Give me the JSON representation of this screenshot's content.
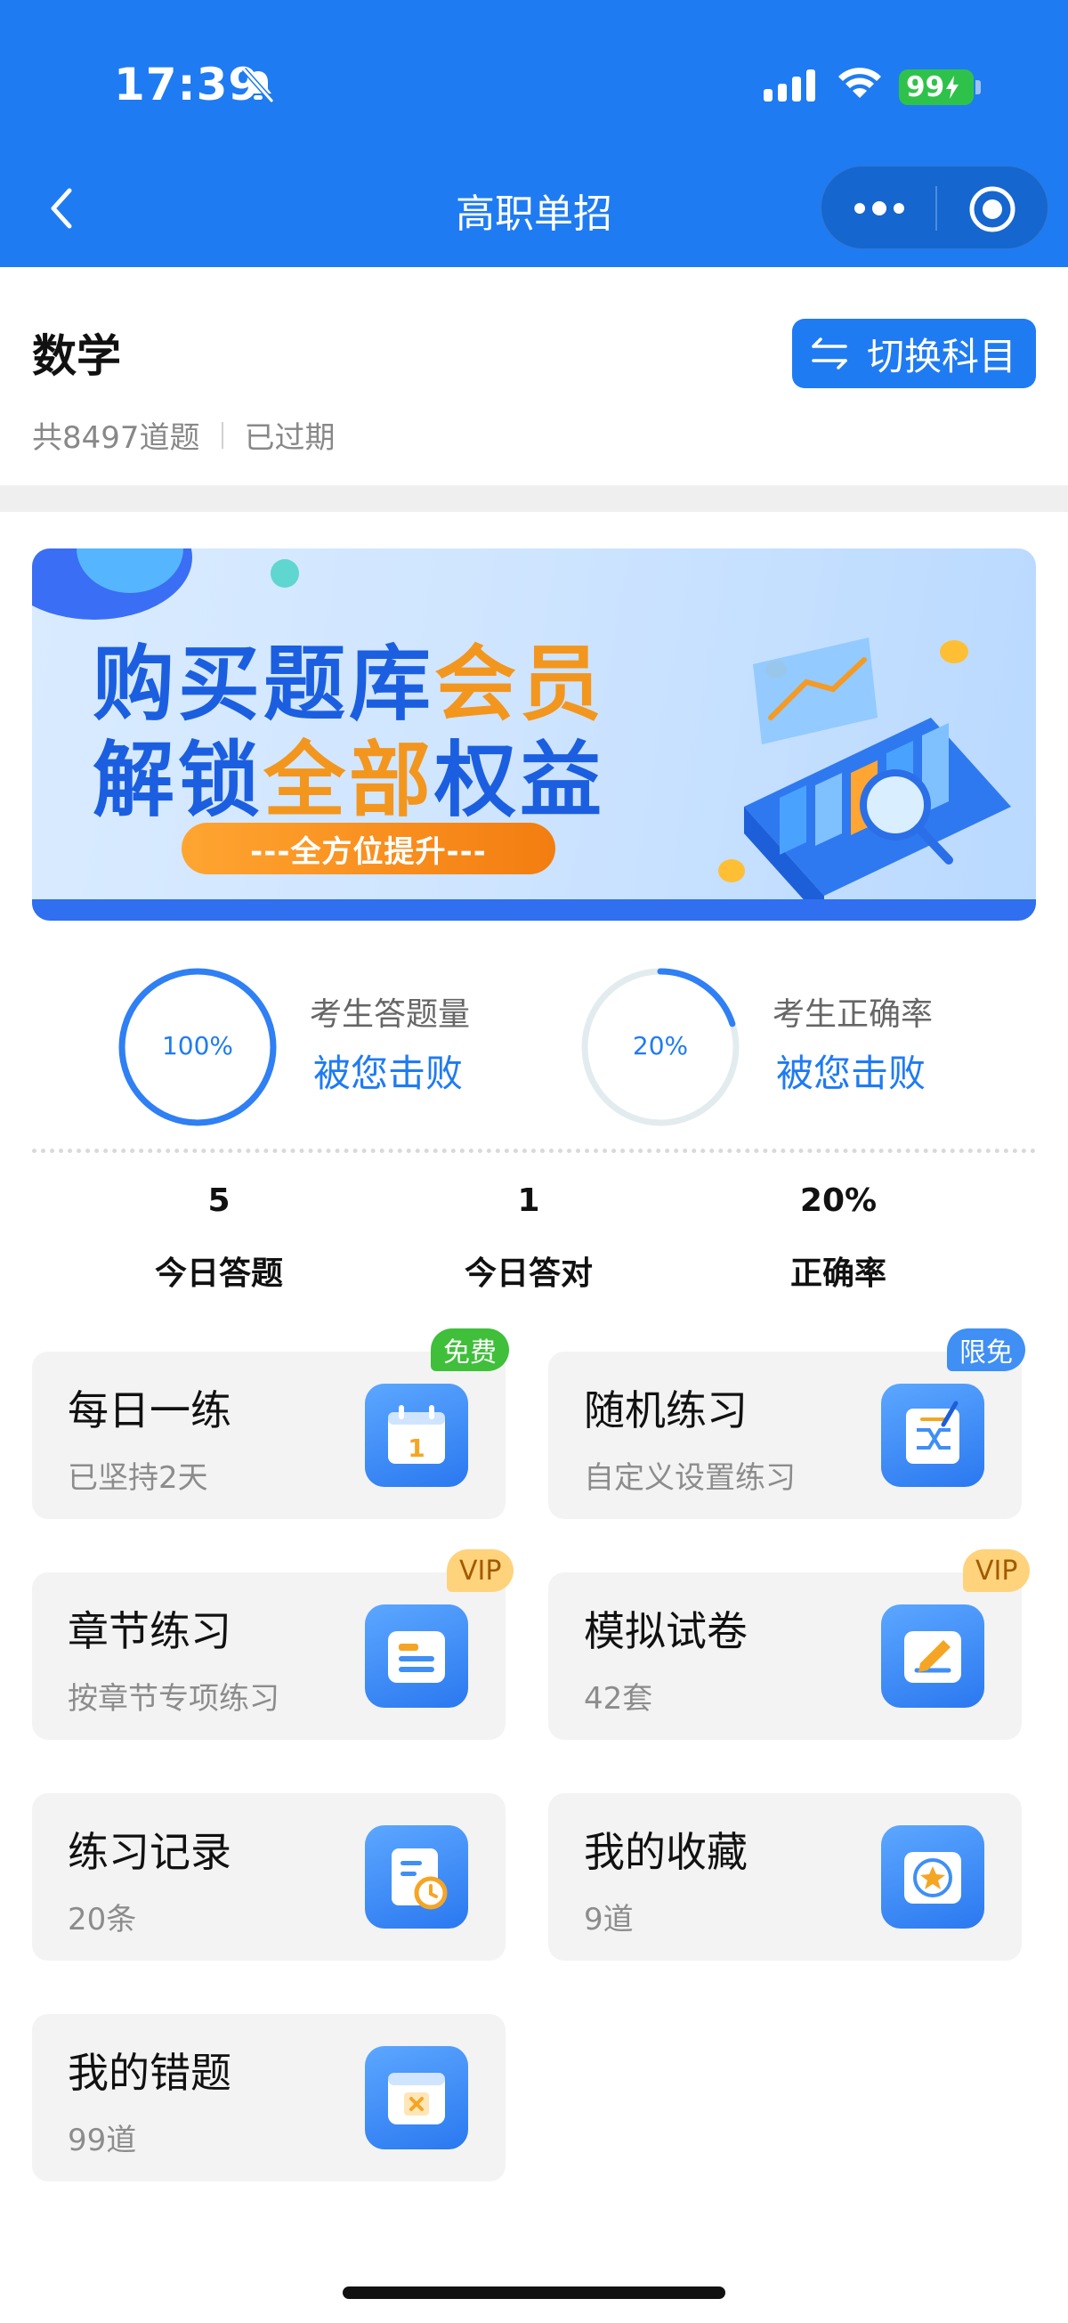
{
  "status_bar": {
    "time": "17:39",
    "battery": "99"
  },
  "nav": {
    "title": "高职单招"
  },
  "subject": {
    "title": "数学",
    "switch_label": "切换科目",
    "question_count": "共8497道题",
    "status": "已过期"
  },
  "banner": {
    "line1_a": "购买题库",
    "line1_b": "会员",
    "line2_a": "解锁",
    "line2_b": "全部",
    "line2_c": "权益",
    "pill": "---全方位提升---"
  },
  "rings": [
    {
      "percent_text": "100%",
      "value": 1.0,
      "label": "考生答题量",
      "value_text": "被您击败"
    },
    {
      "percent_text": "20%",
      "value": 0.2,
      "label": "考生正确率",
      "value_text": "被您击败"
    }
  ],
  "today": [
    {
      "value": "5",
      "label": "今日答题"
    },
    {
      "value": "1",
      "label": "今日答对"
    },
    {
      "value": "20%",
      "label": "正确率"
    }
  ],
  "cards": [
    {
      "title": "每日一练",
      "sub": "已坚持2天",
      "tag": "免费",
      "icon": "calendar-icon"
    },
    {
      "title": "随机练习",
      "sub": "自定义设置练习",
      "tag": "限免",
      "icon": "shuffle-icon"
    },
    {
      "title": "章节练习",
      "sub": "按章节专项练习",
      "tag": "VIP",
      "icon": "folder-icon"
    },
    {
      "title": "模拟试卷",
      "sub": "42套",
      "tag": "VIP",
      "icon": "exam-pen-icon"
    },
    {
      "title": "练习记录",
      "sub": "20条",
      "icon": "history-icon"
    },
    {
      "title": "我的收藏",
      "sub": "9道",
      "icon": "star-icon"
    },
    {
      "title": "我的错题",
      "sub": "99道",
      "icon": "wrong-icon"
    }
  ],
  "colors": {
    "primary": "#1f7bf2",
    "free_tag": "#3fbf3a",
    "vip_tag": "#ffd37c",
    "accent_orange": "#f3961e"
  }
}
